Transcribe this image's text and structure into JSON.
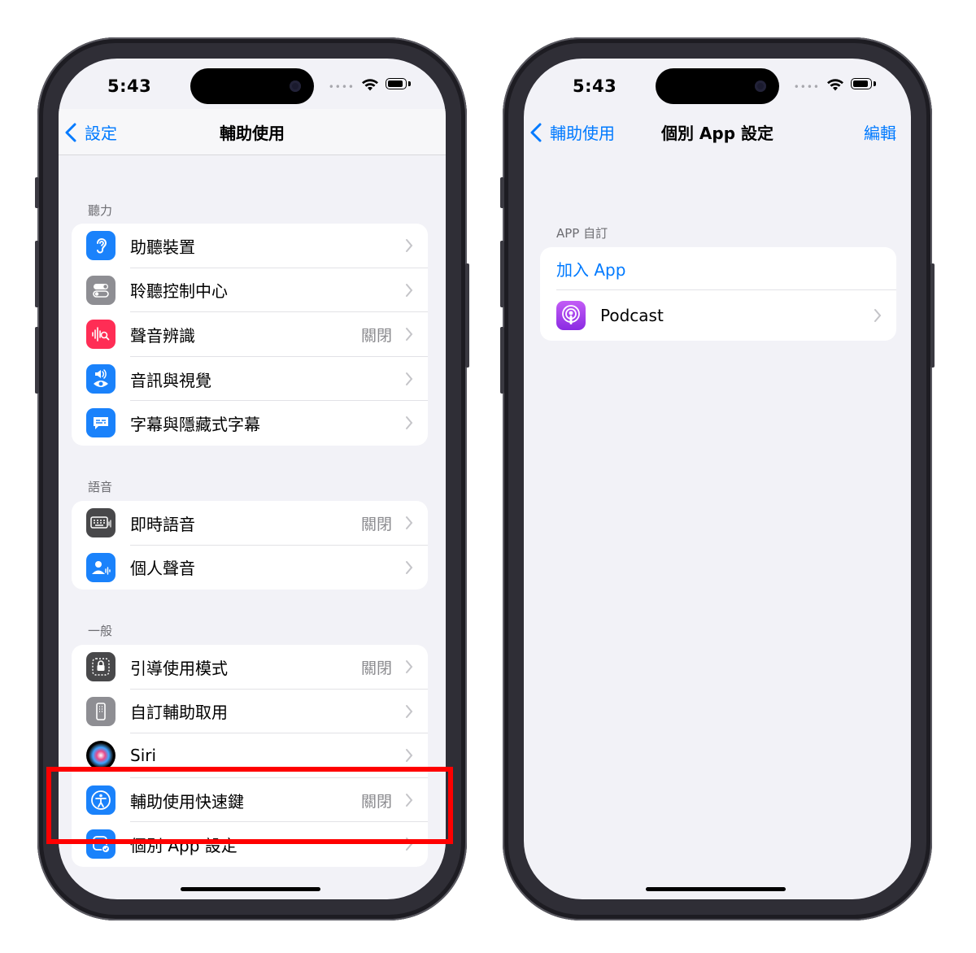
{
  "left_phone": {
    "status_time": "5:43",
    "nav_back": "設定",
    "nav_title": "輔助使用",
    "sections": [
      {
        "header": "聽力",
        "items": [
          {
            "label": "助聽裝置",
            "value": "",
            "icon": "ear-icon",
            "color": "#1a82fb"
          },
          {
            "label": "聆聽控制中心",
            "value": "",
            "icon": "toggle-icon",
            "color": "#8e8e93"
          },
          {
            "label": "聲音辨識",
            "value": "關閉",
            "icon": "waveform-icon",
            "color": "#ff2d55"
          },
          {
            "label": "音訊與視覺",
            "value": "",
            "icon": "speaker-eye-icon",
            "color": "#1a82fb"
          },
          {
            "label": "字幕與隱藏式字幕",
            "value": "",
            "icon": "caption-icon",
            "color": "#1a82fb"
          }
        ]
      },
      {
        "header": "語音",
        "items": [
          {
            "label": "即時語音",
            "value": "關閉",
            "icon": "keyboard-icon",
            "color": "#48484a"
          },
          {
            "label": "個人聲音",
            "value": "",
            "icon": "person-voice-icon",
            "color": "#1a82fb"
          }
        ]
      },
      {
        "header": "一般",
        "items": [
          {
            "label": "引導使用模式",
            "value": "關閉",
            "icon": "lock-icon",
            "color": "#48484a"
          },
          {
            "label": "自訂輔助取用",
            "value": "",
            "icon": "remote-icon",
            "color": "#8e8e93"
          },
          {
            "label": "Siri",
            "value": "",
            "icon": "siri-icon",
            "color": "#000000"
          },
          {
            "label": "輔助使用快速鍵",
            "value": "關閉",
            "icon": "accessibility-icon",
            "color": "#1a82fb"
          },
          {
            "label": "個別 App 設定",
            "value": "",
            "icon": "app-settings-icon",
            "color": "#1a82fb"
          }
        ]
      }
    ]
  },
  "right_phone": {
    "status_time": "5:43",
    "nav_back": "輔助使用",
    "nav_title": "個別 App 設定",
    "nav_edit": "編輯",
    "section_header": "APP 自訂",
    "add_app": "加入 App",
    "apps": [
      {
        "label": "Podcast",
        "icon": "podcast-icon",
        "color": "#9b42e8"
      }
    ]
  },
  "highlight_color": "#ff0000"
}
